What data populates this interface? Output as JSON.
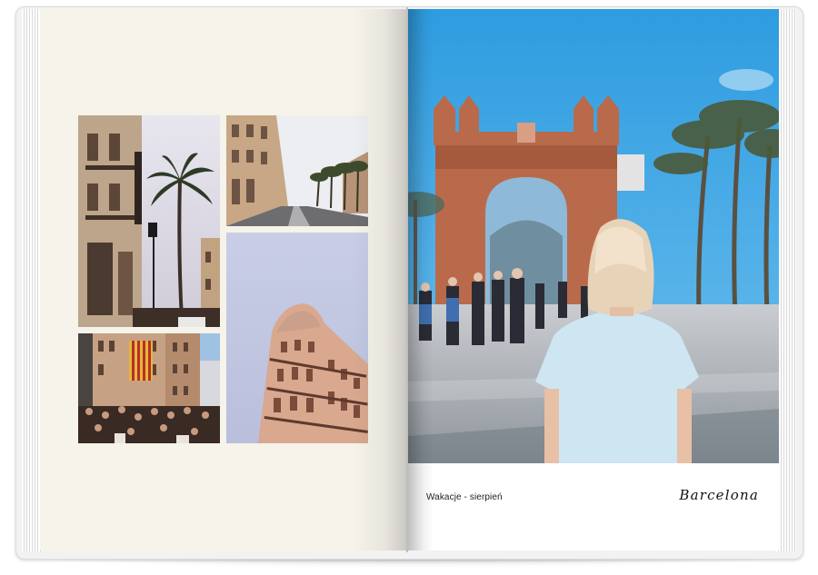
{
  "photobook": {
    "right_page": {
      "caption_left": "Wakacje - sierpień",
      "caption_right": "Barcelona"
    },
    "left_page": {
      "photos": [
        {
          "subject": "street with palm tree and lamp post"
        },
        {
          "subject": "palm-lined avenue"
        },
        {
          "subject": "ornate corner building against sky"
        },
        {
          "subject": "crowd with striped flag on balcony"
        }
      ]
    },
    "hero_photo": {
      "subject": "woman walking toward triumphal arch"
    }
  },
  "colors": {
    "left_page_bg": "#f5f3ea",
    "right_page_bg": "#ffffff",
    "sky_blue": "#2f9fe0",
    "arch_brick": "#b96a4a"
  }
}
